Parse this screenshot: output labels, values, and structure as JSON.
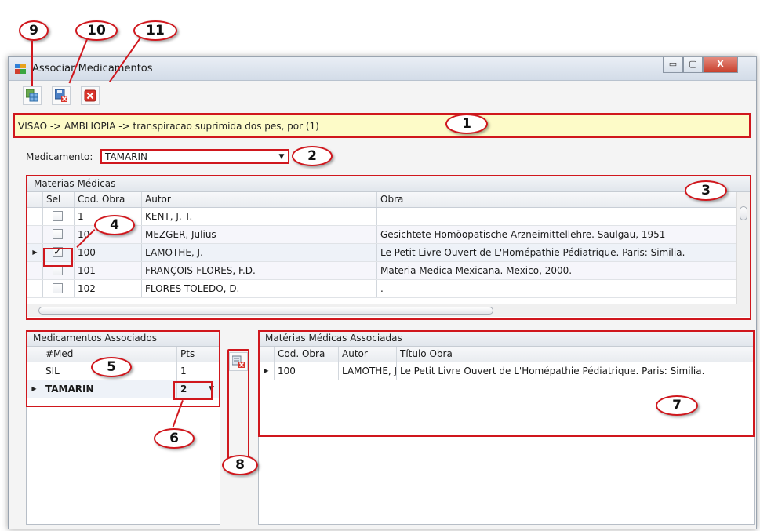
{
  "window": {
    "title": "Associar Medicamentos",
    "controls": {
      "minimize": "▭",
      "maximize": "▢",
      "close": "X"
    }
  },
  "toolbar": {
    "buttons": [
      {
        "icon": "grid-view-icon"
      },
      {
        "icon": "save-cancel-icon"
      },
      {
        "icon": "close-red-icon"
      }
    ]
  },
  "breadcrumb": {
    "text": "VISAO -> AMBLIOPIA -> transpiracao suprimida dos pes, por (1)"
  },
  "medicamento": {
    "label": "Medicamento:",
    "value": "TAMARIN"
  },
  "materias_medicas": {
    "title": "Materias Médicas",
    "columns": [
      "Sel",
      "Cod. Obra",
      "Autor",
      "Obra"
    ],
    "rows": [
      {
        "sel": false,
        "cod": "1",
        "autor": "KENT, J. T.",
        "obra": ""
      },
      {
        "sel": false,
        "cod": "10",
        "autor": "MEZGER, Julius",
        "obra": "Gesichtete Homöopatische Arzneimittellehre. Saulgau, 1951"
      },
      {
        "sel": true,
        "cod": "100",
        "autor": "LAMOTHE, J.",
        "obra": "Le Petit Livre Ouvert de L'Homépathie Pédiatrique. Paris: Similia."
      },
      {
        "sel": false,
        "cod": "101",
        "autor": "FRANÇOIS-FLORES, F.D.",
        "obra": "Materia Medica Mexicana. Mexico, 2000."
      },
      {
        "sel": false,
        "cod": "102",
        "autor": "FLORES TOLEDO, D.",
        "obra": "."
      }
    ]
  },
  "medicamentos_associados": {
    "title": "Medicamentos Associados",
    "columns": [
      "#Med",
      "Pts"
    ],
    "rows": [
      {
        "med": "SIL",
        "pts": "1"
      },
      {
        "med": "TAMARIN",
        "pts": "2"
      }
    ]
  },
  "materias_associadas": {
    "title": "Matérias Médicas Associadas",
    "columns": [
      "Cod. Obra",
      "Autor",
      "Título Obra"
    ],
    "rows": [
      {
        "cod": "100",
        "autor": "LAMOTHE, J.",
        "titulo": "Le Petit Livre Ouvert de L'Homépathie Pédiatrique. Paris: Similia."
      }
    ]
  },
  "callouts": [
    "1",
    "2",
    "3",
    "4",
    "5",
    "6",
    "7",
    "8",
    "9",
    "10",
    "11"
  ],
  "colors": {
    "callout_red": "#d0171d",
    "breadcrumb_bg": "#fdfbc8"
  }
}
